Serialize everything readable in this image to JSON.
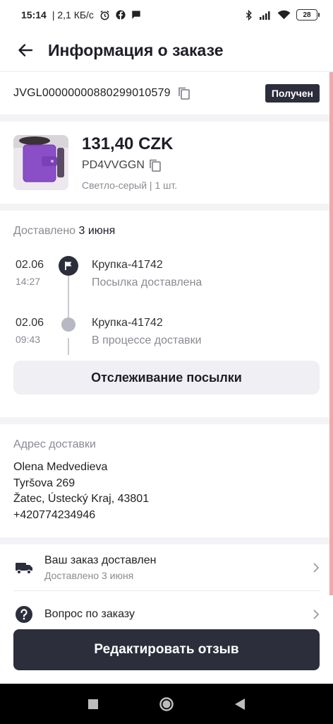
{
  "status_bar": {
    "time": "15:14",
    "network_speed": "| 2,1 КБ/с",
    "battery_level": "28",
    "icons": [
      "alarm-icon",
      "facebook-icon",
      "message-icon",
      "bluetooth-icon",
      "signal-icon",
      "wifi-icon",
      "battery-icon"
    ]
  },
  "header": {
    "title": "Информация о заказе"
  },
  "order": {
    "id": "JVGL00000000880299010579",
    "status": "Получен"
  },
  "product": {
    "price": "131,40 CZK",
    "sku": "PD4VVGGN",
    "variant": "Светло-серый | 1 шт."
  },
  "delivery": {
    "label": "Доставлено",
    "date": "3 июня",
    "events": [
      {
        "date": "02.06",
        "time": "14:27",
        "place": "Крупка-41742",
        "desc": "Посылка доставлена"
      },
      {
        "date": "02.06",
        "time": "09:43",
        "place": "Крупка-41742",
        "desc": "В процессе доставки"
      }
    ],
    "track_button": "Отслеживание посылки"
  },
  "address": {
    "label": "Адрес доставки",
    "name": "Olena Medvedieva",
    "street": "Tyršova 269",
    "city": "Žatec, Ústecký Kraj, 43801",
    "phone": "+420774234946"
  },
  "rows": [
    {
      "title": "Ваш заказ доставлен",
      "subtitle": "Доставлено 3 июня",
      "icon": "truck-icon"
    },
    {
      "title": "Вопрос по заказу",
      "subtitle": "",
      "icon": "question-icon"
    }
  ],
  "bottom_button": "Редактировать отзыв",
  "colors": {
    "primary_dark": "#2c2e3c",
    "muted_text": "#8a8b93",
    "scrollbar": "#f0a8aa",
    "background": "#f3f3f6"
  }
}
